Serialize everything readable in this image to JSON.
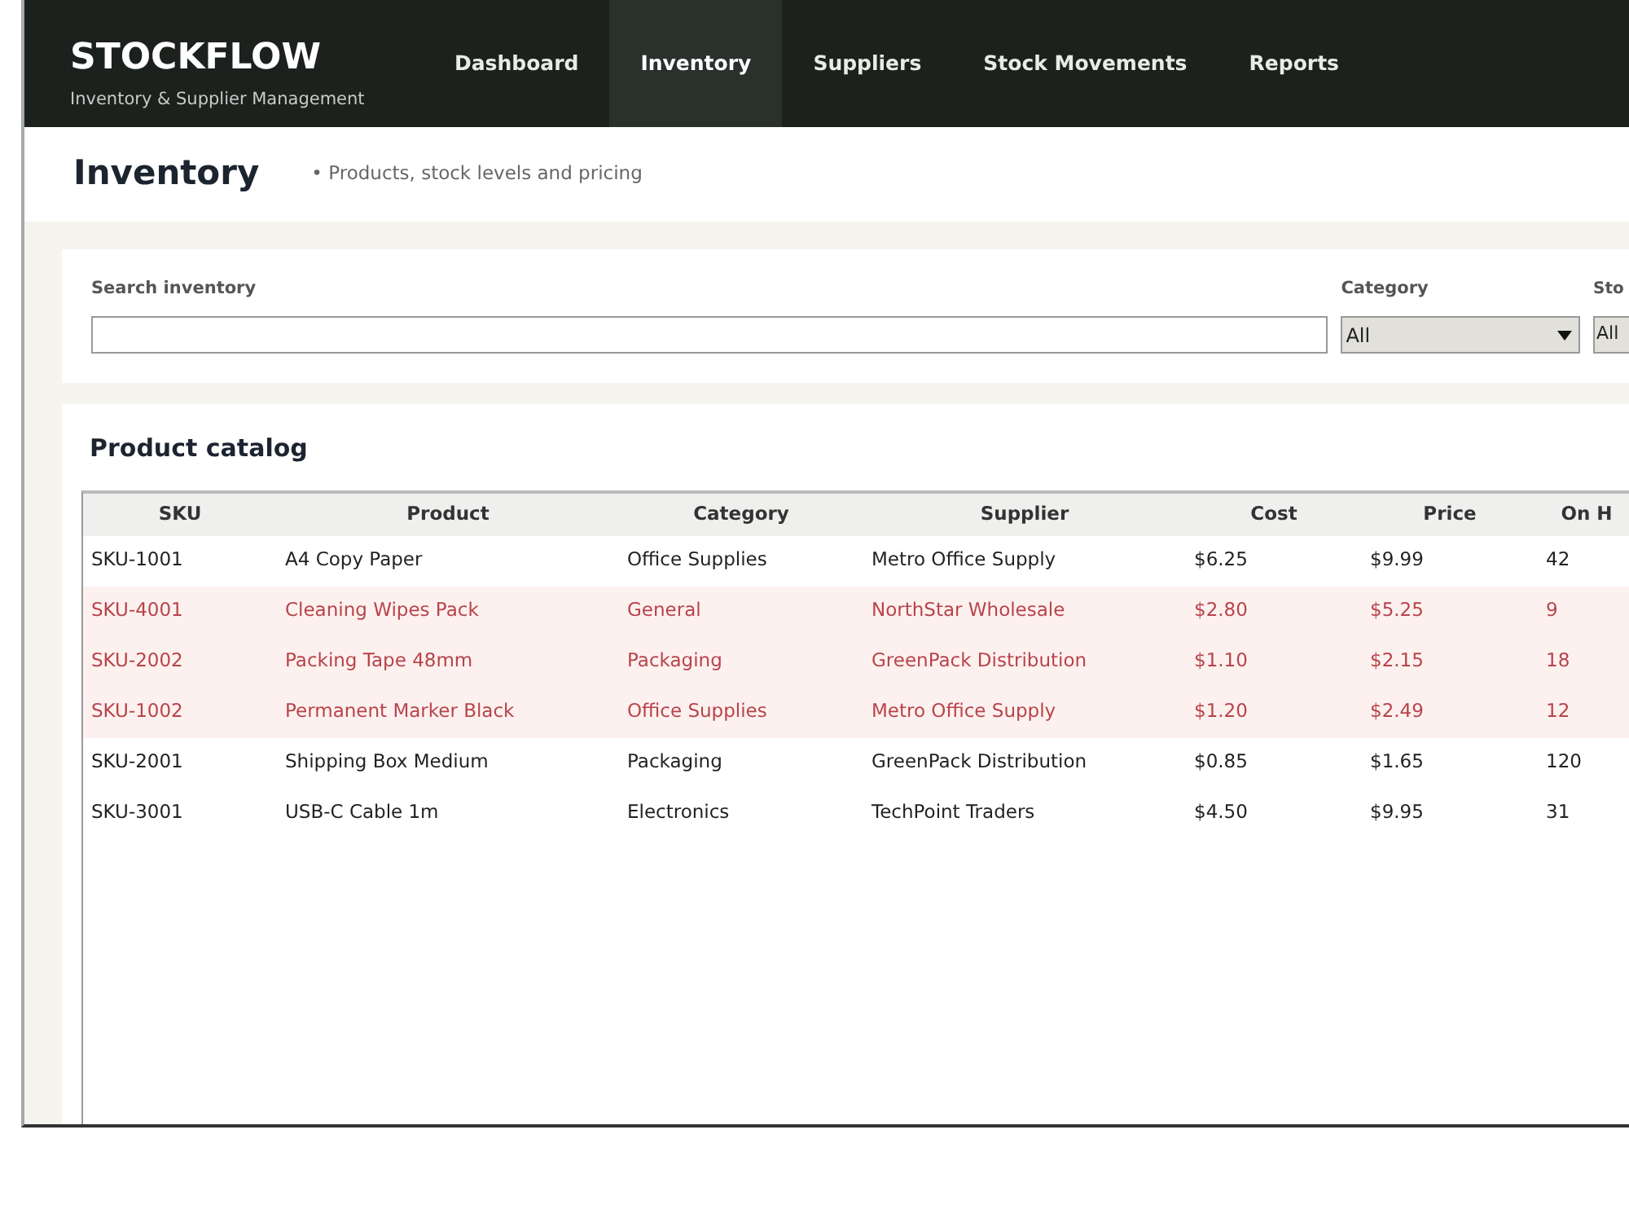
{
  "brand": {
    "title": "STOCKFLOW",
    "subtitle": "Inventory & Supplier Management"
  },
  "nav": [
    {
      "label": "Dashboard",
      "selected": false
    },
    {
      "label": "Inventory",
      "selected": true
    },
    {
      "label": "Suppliers",
      "selected": false
    },
    {
      "label": "Stock Movements",
      "selected": false
    },
    {
      "label": "Reports",
      "selected": false
    }
  ],
  "page": {
    "title": "Inventory",
    "subtitle": "• Products, stock levels and pricing"
  },
  "filters": {
    "search": {
      "label": "Search inventory"
    },
    "category": {
      "label": "Category",
      "value": "All"
    },
    "filter_3": {
      "label": "Sto",
      "value": "All"
    }
  },
  "catalog": {
    "title": "Product catalog",
    "columns": [
      "SKU",
      "Product",
      "Category",
      "Supplier",
      "Cost",
      "Price",
      "On H"
    ],
    "rows": [
      {
        "cells": [
          "SKU-1001",
          "A4 Copy Paper",
          "Office Supplies",
          "Metro Office Supply",
          "$6.25",
          "$9.99",
          "42"
        ],
        "low_stock": false
      },
      {
        "cells": [
          "SKU-4001",
          "Cleaning Wipes Pack",
          "General",
          "NorthStar Wholesale",
          "$2.80",
          "$5.25",
          "9"
        ],
        "low_stock": true
      },
      {
        "cells": [
          "SKU-2002",
          "Packing Tape 48mm",
          "Packaging",
          "GreenPack Distribution",
          "$1.10",
          "$2.15",
          "18"
        ],
        "low_stock": true
      },
      {
        "cells": [
          "SKU-1002",
          "Permanent Marker Black",
          "Office Supplies",
          "Metro Office Supply",
          "$1.20",
          "$2.49",
          "12"
        ],
        "low_stock": true
      },
      {
        "cells": [
          "SKU-2001",
          "Shipping Box Medium",
          "Packaging",
          "GreenPack Distribution",
          "$0.85",
          "$1.65",
          "120"
        ],
        "low_stock": false
      },
      {
        "cells": [
          "SKU-3001",
          "USB-C Cable 1m",
          "Electronics",
          "TechPoint Traders",
          "$4.50",
          "$9.95",
          "31"
        ],
        "low_stock": false
      }
    ]
  }
}
